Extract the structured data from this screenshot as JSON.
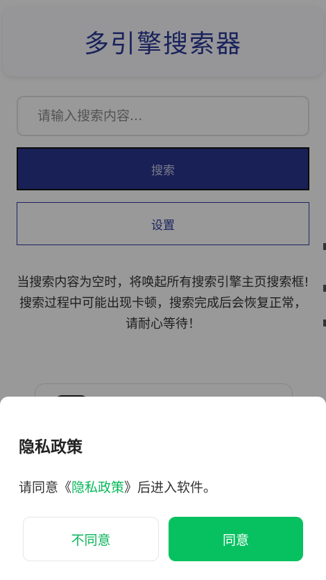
{
  "app": {
    "title": "多引擎搜索器"
  },
  "search": {
    "placeholder": "请输入搜索内容...",
    "value": ""
  },
  "buttons": {
    "search_label": "搜索",
    "settings_label": "设置"
  },
  "notice": {
    "line1": "当搜索内容为空时，将唤起所有搜索引擎主页搜索框!",
    "line2": "搜索过程中可能出现卡顿，搜索完成后会恢复正常，请耐心等待！"
  },
  "privacy_dialog": {
    "title": "隐私政策",
    "text_before": "请同意《",
    "link_label": "隐私政策",
    "text_after": "》后进入软件。",
    "disagree_label": "不同意",
    "agree_label": "同意"
  },
  "colors": {
    "brand": "#2b3a9a",
    "search_button": "#2a3690",
    "accent_green": "#07c160"
  }
}
